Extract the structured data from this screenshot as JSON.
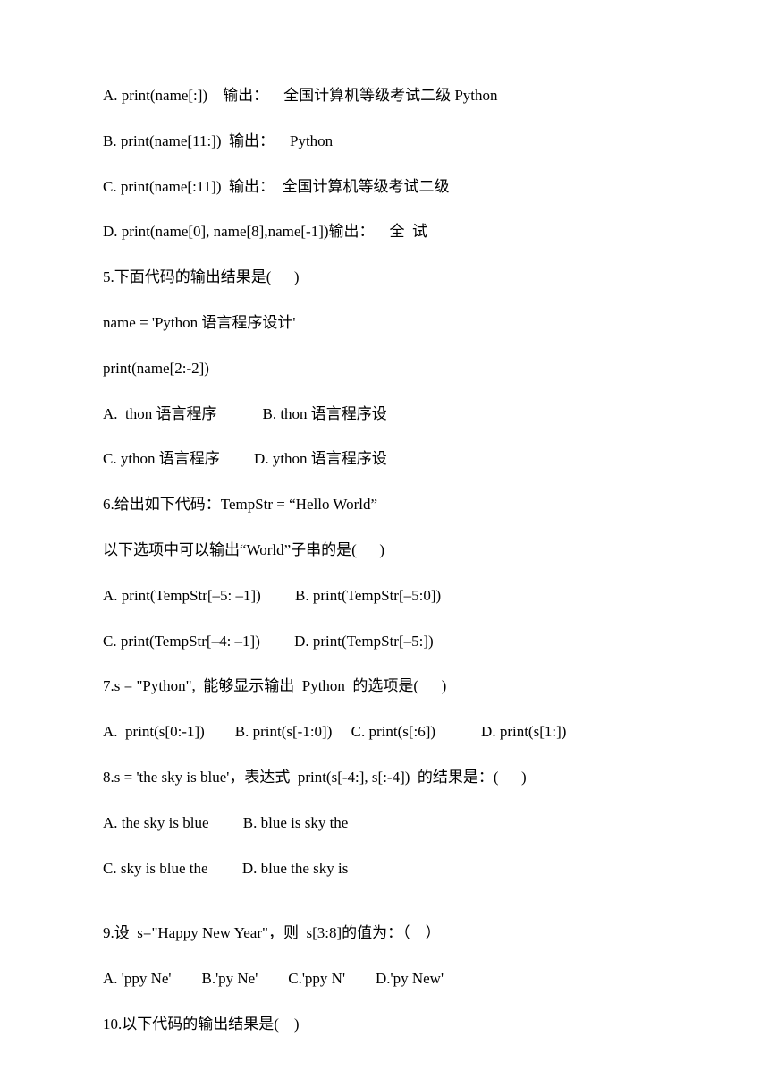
{
  "lines": {
    "l01": "A. print(name[:]) 输出： 全国计算机等级考试二级 Python",
    "l02": "B. print(name[11:])  输出： Python",
    "l03": "C. print(name[:11])  输出：  全国计算机等级考试二级",
    "l04": "D. print(name[0], name[8],name[-1])输出： 全  试",
    "l05": "5.下面代码的输出结果是(   )",
    "l06": "name = 'Python 语言程序设计'",
    "l07": "print(name[2:-2])",
    "l08": "A.  thon 语言程序   B. thon 语言程序设",
    "l09": "C. ython 语言程序   D. ython 语言程序设",
    "l10": "6.给出如下代码：TempStr = “Hello World”",
    "l11": "以下选项中可以输出“World”子串的是(   )",
    "l12": "A. print(TempStr[–5: –1])   B. print(TempStr[–5:0])",
    "l13": "C. print(TempStr[–4: –1])   D. print(TempStr[–5:])",
    "l14": "7.s = \"Python\",  能够显示输出  Python  的选项是(   )",
    "l15": "A.  print(s[0:-1])  B. print(s[-1:0])  C. print(s[:6])   D. print(s[1:])",
    "l16": "8.s = 'the sky is blue'，表达式  print(s[-4:], s[:-4])  的结果是：(   )",
    "l17": "A. the sky is blue   B. blue is sky the",
    "l18": "C. sky is blue the   D. blue the sky is",
    "l19": "9.设  s=\"Happy New Year\"，则  s[3:8]的值为：（ ）",
    "l20": "A. 'ppy Ne'  B.'py Ne'  C.'ppy N'  D.'py New'",
    "l21": "10.以下代码的输出结果是( )"
  }
}
